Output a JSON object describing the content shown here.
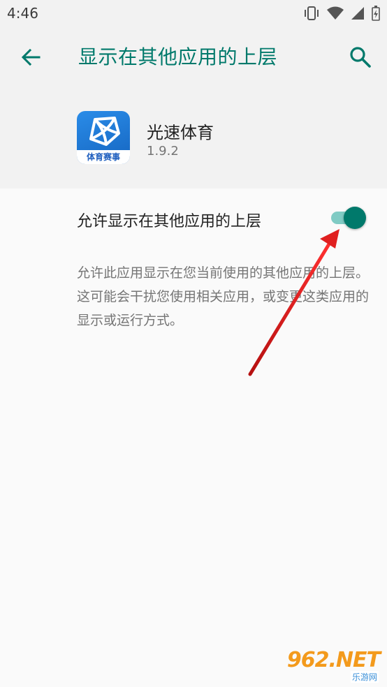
{
  "status_bar": {
    "time": "4:46",
    "icons": [
      "vibrate-icon",
      "wifi-icon",
      "signal-icon",
      "battery-icon"
    ]
  },
  "header": {
    "title": "显示在其他应用的上层",
    "back_icon": "arrow-left-icon",
    "search_icon": "search-icon"
  },
  "app": {
    "name": "光速体育",
    "version": "1.9.2",
    "icon_label": "体育赛事"
  },
  "setting": {
    "label": "允许显示在其他应用的上层",
    "enabled": true
  },
  "description": "允许此应用显示在您当前使用的其他应用的上层。这可能会干扰您使用相关应用，或变更这类应用的显示或运行方式。",
  "watermark": {
    "main": "962.NET",
    "sub": "乐游网"
  },
  "colors": {
    "accent": "#00796b",
    "accent_light": "#80cbc4",
    "arrow": "#e02020"
  }
}
